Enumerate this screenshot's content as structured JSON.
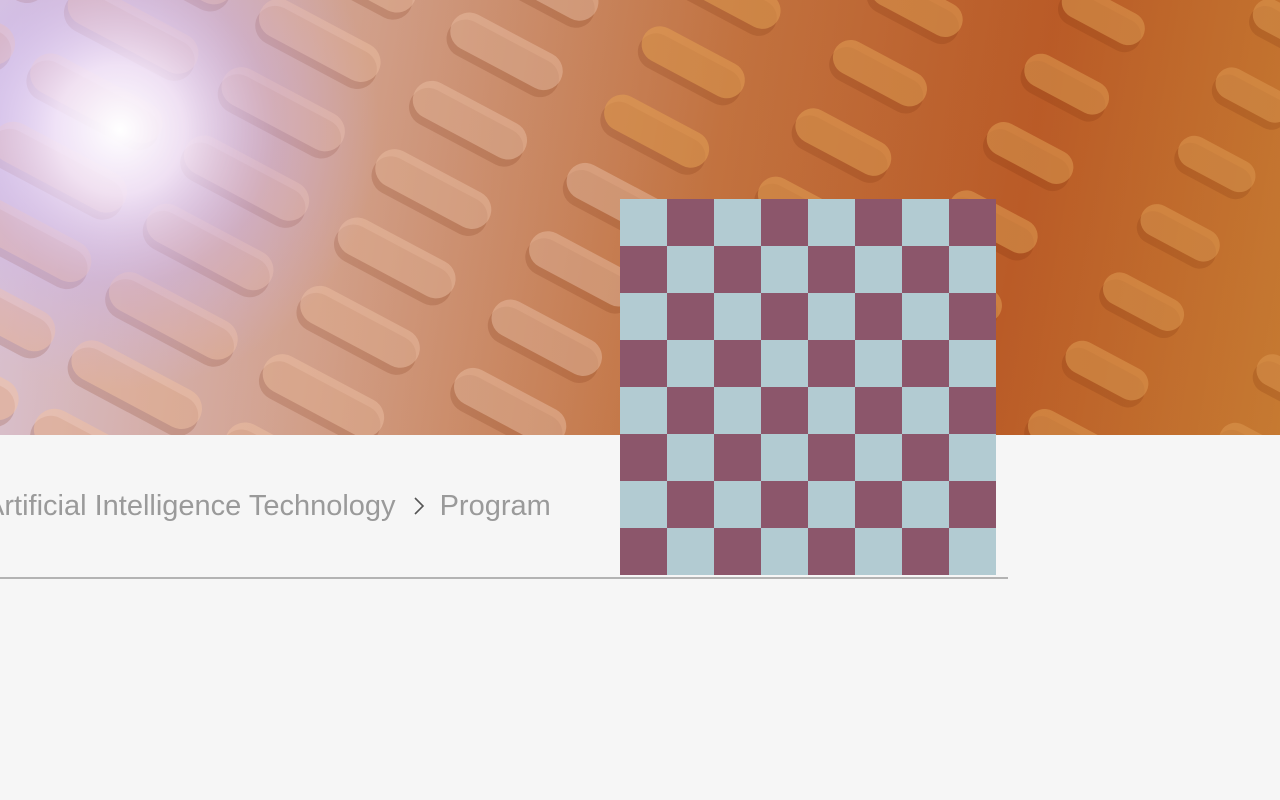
{
  "hero": {
    "image_icon": "abstract-orange-pill-pattern-image"
  },
  "breadcrumb": {
    "items": [
      {
        "label": "e and Artificial Intelligence Technology"
      },
      {
        "label": "Program"
      }
    ],
    "separator_icon": "chevron-right-icon"
  },
  "checker_image": {
    "icon": "checkerboard-placeholder-image",
    "colors": {
      "light": "#b2cbd2",
      "dark": "#8c566b"
    },
    "rows": 8,
    "cols": 8
  },
  "colors": {
    "page_background": "#f6f6f6",
    "breadcrumb_text": "#9a9a9a",
    "divider": "#b3b3b3"
  }
}
